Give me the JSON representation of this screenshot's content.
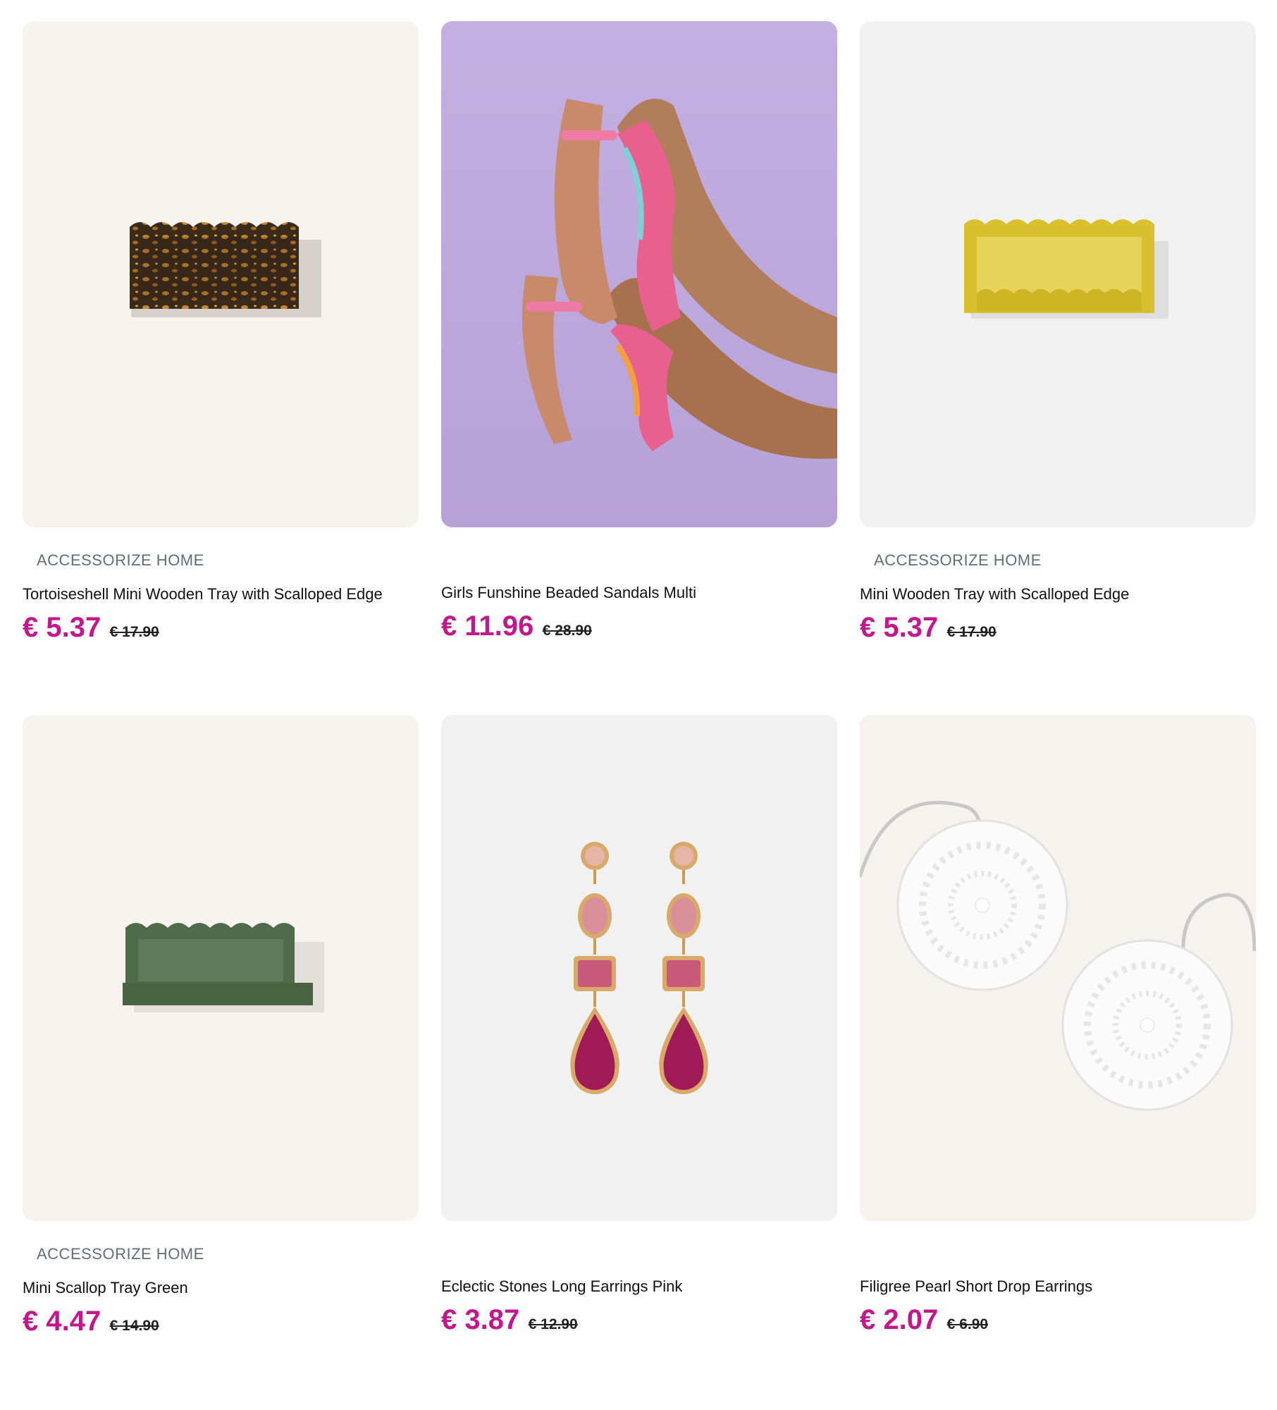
{
  "products": [
    {
      "brand": "ACCESSORIZE HOME",
      "title": "Tortoiseshell Mini Wooden Tray with Scalloped Edge",
      "price": "€ 5.37",
      "old_price": "€ 17.90",
      "bg": "#f7f3ee",
      "icon": "tortoiseshell-tray-image"
    },
    {
      "brand": "",
      "title": "Girls Funshine Beaded Sandals Multi",
      "price": "€ 11.96",
      "old_price": "€ 28.90",
      "bg": "#c9b7e4",
      "icon": "beaded-sandals-image"
    },
    {
      "brand": "ACCESSORIZE HOME",
      "title": "Mini Wooden Tray with Scalloped Edge",
      "price": "€ 5.37",
      "old_price": "€ 17.90",
      "bg": "#f1f1f1",
      "icon": "yellow-tray-image"
    },
    {
      "brand": "ACCESSORIZE HOME",
      "title": "Mini Scallop Tray Green",
      "price": "€ 4.47",
      "old_price": "€ 14.90",
      "bg": "#f7f3ee",
      "icon": "green-tray-image"
    },
    {
      "brand": "",
      "title": "Eclectic Stones Long Earrings Pink",
      "price": "€ 3.87",
      "old_price": "€ 12.90",
      "bg": "#f1f1f1",
      "icon": "pink-earrings-image"
    },
    {
      "brand": "",
      "title": "Filigree Pearl Short Drop Earrings",
      "price": "€ 2.07",
      "old_price": "€ 6.90",
      "bg": "#f6f2ed",
      "icon": "filigree-earrings-image"
    }
  ],
  "colors": {
    "price": "#c2188c",
    "brand": "#5f6f78"
  }
}
